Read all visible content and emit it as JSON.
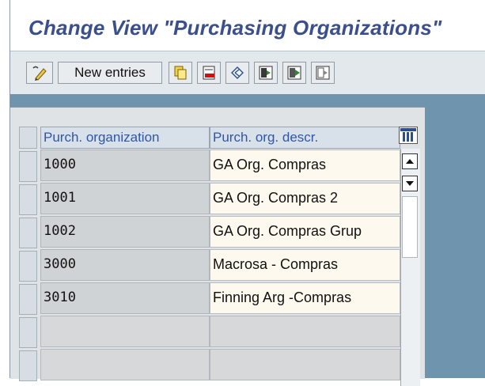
{
  "window": {
    "title": "Change View \"Purchasing Organizations\"",
    "accent_color": "#3a4f8c"
  },
  "toolbar": {
    "new_entries_label": "New entries",
    "icons": [
      "display-change-icon",
      "copy-as-icon",
      "delete-icon",
      "undo-icon",
      "select-all-icon",
      "select-block-icon",
      "deselect-all-icon"
    ]
  },
  "table": {
    "headers": [
      "Purch. organization",
      "Purch. org. descr."
    ],
    "rows": [
      {
        "org": "1000",
        "descr": "GA Org. Compras"
      },
      {
        "org": "1001",
        "descr": "GA Org. Compras 2"
      },
      {
        "org": "1002",
        "descr": "GA Org. Compras Grup"
      },
      {
        "org": "3000",
        "descr": "Macrosa - Compras"
      },
      {
        "org": "3010",
        "descr": "Finning Arg -Compras"
      }
    ],
    "empty_rows": 3
  }
}
